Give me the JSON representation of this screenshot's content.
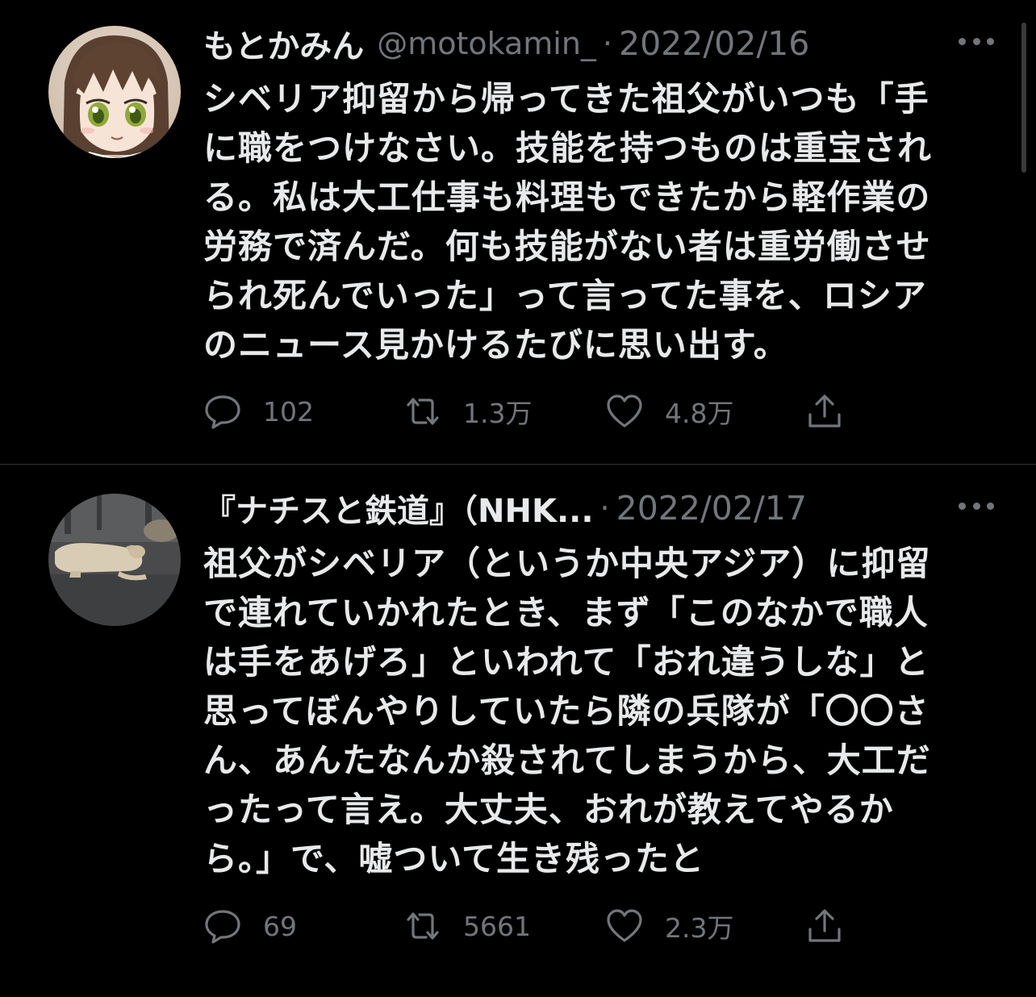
{
  "tweets": [
    {
      "name": "もとかみん",
      "handle": "@motokamin_",
      "separator": "·",
      "date": "2022/02/16",
      "text": "シベリア抑留から帰ってきた祖父がいつも「手に職をつけなさい。技能を持つものは重宝される。私は大工仕事も料理もできたから軽作業の労務で済んだ。何も技能がない者は重労働させられ死んでいった」って言ってた事を、ロシアのニュース見かけるたびに思い出す。",
      "lines": [
        "シベリア抑留から帰ってきた祖父がいつも「手",
        "に職をつけなさい。技能を持つものは重宝され",
        "る。私は大工仕事も料理もできたから軽作業の",
        "労務で済んだ。何も技能がない者は重労働させ",
        "られ死んでいった」って言ってた事を、ロシア",
        "のニュース見かけるたびに思い出す。"
      ],
      "replies": "102",
      "retweets": "1.3万",
      "likes": "4.8万"
    },
    {
      "name": "『ナチスと鉄道』（NHK...",
      "handle": "",
      "separator": "·",
      "date": "2022/02/17",
      "lines": [
        "祖父がシベリア（というか中央アジア）に抑留",
        "で連れていかれたとき、まず「このなかで職人",
        "は手をあげろ」といわれて「おれ違うしな」と",
        "思ってぼんやりしていたら隣の兵隊が「〇〇さ",
        "ん、あんたなんか殺されてしまうから、大工だ",
        "ったって言え。大丈夫、おれが教えてやるか",
        "ら。」で、嘘ついて生き残ったと"
      ],
      "replies": "69",
      "retweets": "5661",
      "likes": "2.3万"
    }
  ],
  "icons": {
    "reply": "speech-bubble-icon",
    "retweet": "retweet-arrows-icon",
    "like": "heart-icon",
    "share": "share-upload-icon",
    "more": "more-dots-icon"
  },
  "colors": {
    "background": "#000000",
    "text": "#e7e9ea",
    "muted": "#71767b"
  }
}
